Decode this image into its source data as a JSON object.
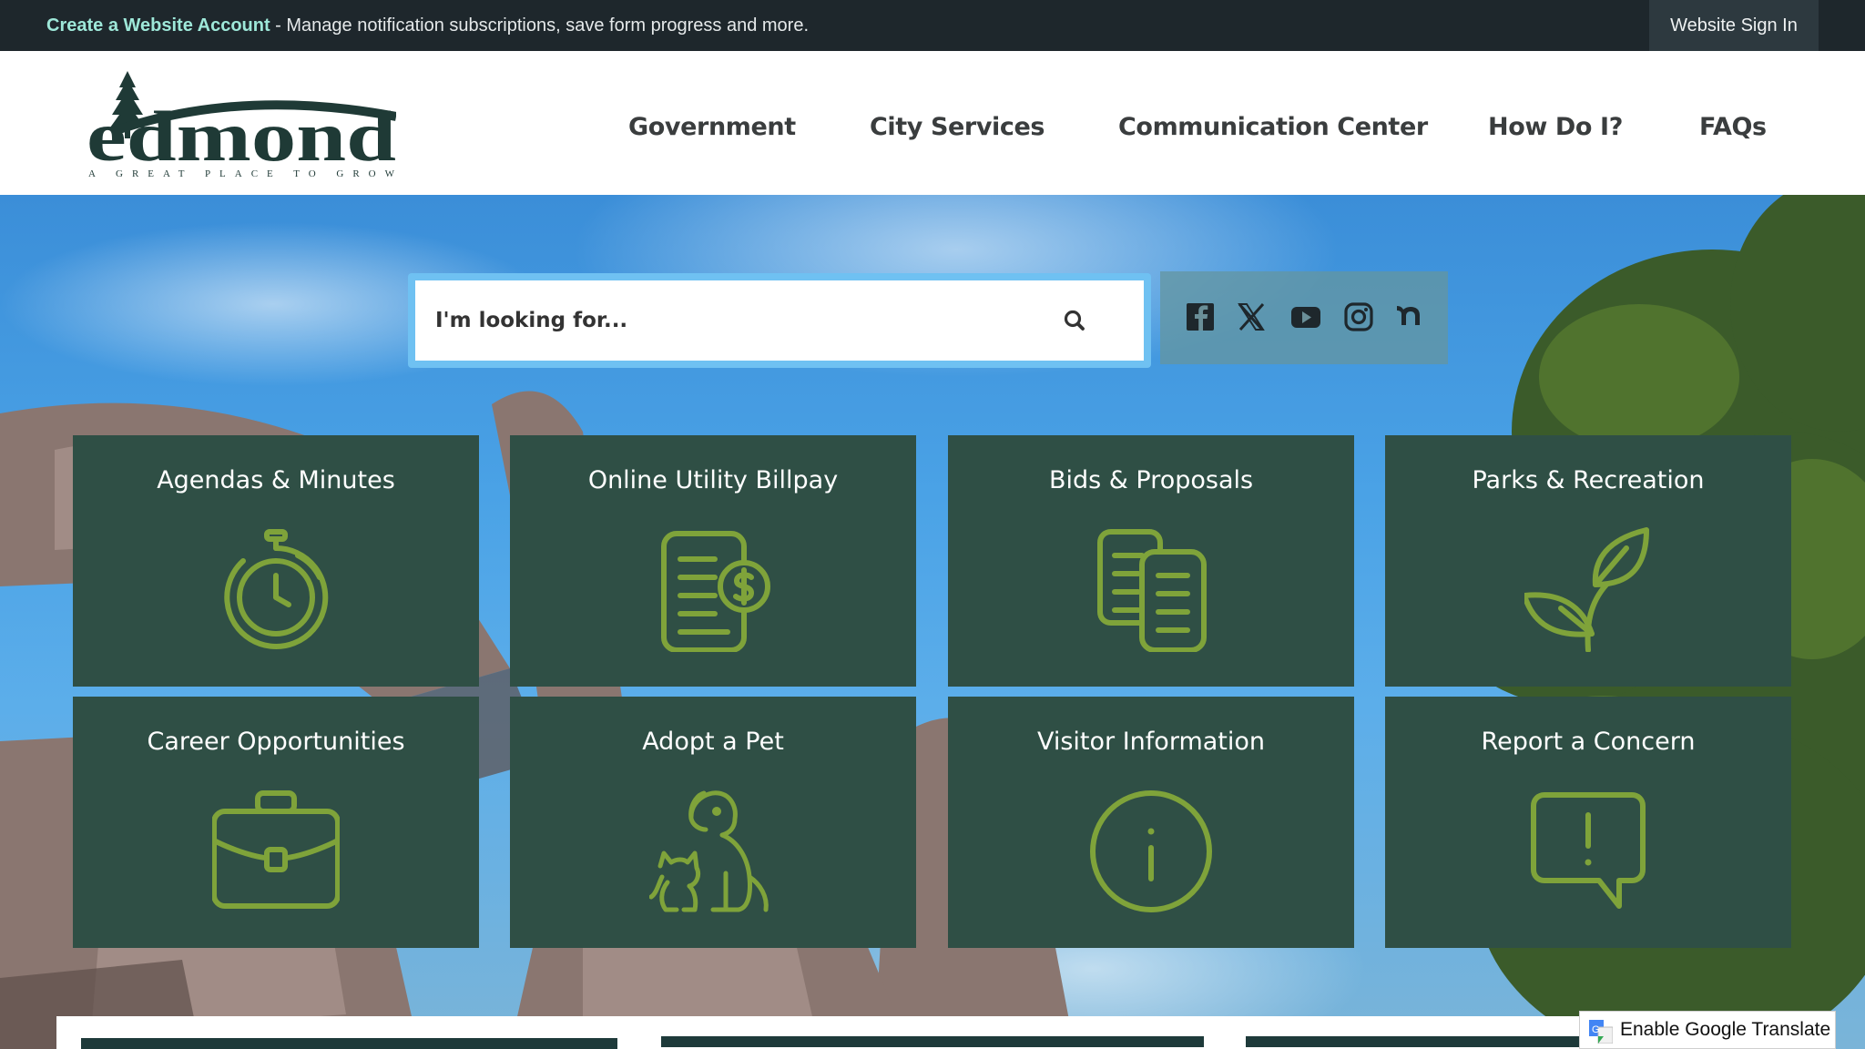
{
  "topbar": {
    "create_account": "Create a Website Account",
    "message": " - Manage notification subscriptions, save form progress and more.",
    "signin": "Website Sign In"
  },
  "logo": {
    "wordmark": "edmond",
    "tagline": "A GREAT PLACE TO GROW"
  },
  "nav": [
    "Government",
    "City Services",
    "Communication Center",
    "How Do I?",
    "FAQs"
  ],
  "search": {
    "placeholder": "I'm looking for...",
    "icon": "search-icon"
  },
  "social": [
    "facebook-icon",
    "x-twitter-icon",
    "youtube-icon",
    "instagram-icon",
    "nextdoor-icon"
  ],
  "tiles": [
    {
      "label": "Agendas & Minutes",
      "icon": "stopwatch-icon"
    },
    {
      "label": "Online Utility Billpay",
      "icon": "bill-dollar-icon"
    },
    {
      "label": "Bids & Proposals",
      "icon": "documents-icon"
    },
    {
      "label": "Parks & Recreation",
      "icon": "sprout-icon"
    },
    {
      "label": "Career Opportunities",
      "icon": "briefcase-icon"
    },
    {
      "label": "Adopt a Pet",
      "icon": "dog-cat-icon"
    },
    {
      "label": "Visitor Information",
      "icon": "info-icon"
    },
    {
      "label": "Report a Concern",
      "icon": "chat-alert-icon"
    }
  ],
  "translate": {
    "label": "Enable Google Translate"
  },
  "colors": {
    "topbar": "#1e272c",
    "tile": "#2f4f45",
    "icon_green": "#7fa33a",
    "nav_text": "#3a3d3e"
  }
}
